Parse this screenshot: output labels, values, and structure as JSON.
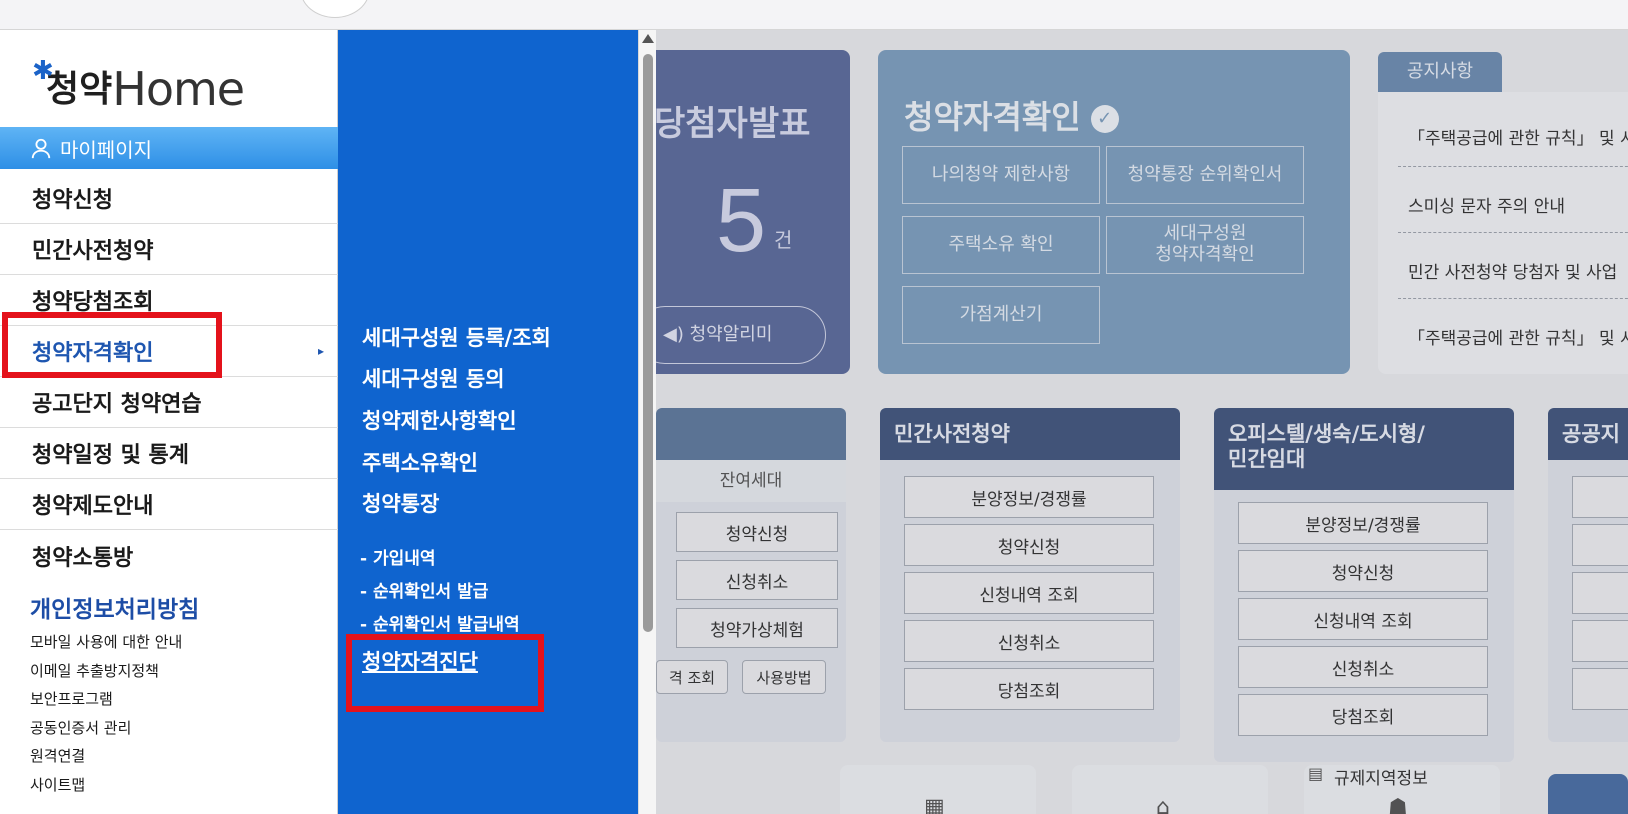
{
  "logo": {
    "mark": "청약",
    "text": "Home"
  },
  "mypage": {
    "label": "마이페이지"
  },
  "menu": [
    {
      "label": "청약신청"
    },
    {
      "label": "민간사전청약"
    },
    {
      "label": "청약당첨조회"
    },
    {
      "label": "청약자격확인",
      "arrow": "▸"
    },
    {
      "label": "공고단지 청약연습"
    },
    {
      "label": "청약일정 및 통계"
    },
    {
      "label": "청약제도안내"
    },
    {
      "label": "청약소통방"
    }
  ],
  "privacy_label": "개인정보처리방침",
  "links": [
    "모바일 사용에 대한 안내",
    "이메일 추출방지정책",
    "보안프로그램",
    "공동인증서 관리",
    "원격연결",
    "사이트맵"
  ],
  "submenu": {
    "items": [
      "세대구성원 등록/조회",
      "세대구성원 동의",
      "청약제한사항확인",
      "주택소유확인",
      "청약통장"
    ],
    "sub_items": [
      "- 가입내역",
      "- 순위확인서 발급",
      "- 순위확인서 발급내역"
    ],
    "diagnosis": "청약자격진단"
  },
  "background": {
    "winner": {
      "title": "당첨자발표",
      "count": "5",
      "unit": "건",
      "alarm": "청약알리미"
    },
    "eligibility": {
      "title": "청약자격확인",
      "buttons": [
        "나의청약 제한사항",
        "청약통장 순위확인서",
        "주택소유 확인",
        "세대구성원\n청약자격확인",
        "가점계산기"
      ]
    },
    "notice": {
      "tab": "공지사항",
      "items": [
        "「주택공급에 관한 규칙」 및 시",
        "스미싱 문자 주의 안내",
        "민간 사전청약 당첨자 및 사업",
        "「주택공급에 관한 규칙」 및 시"
      ]
    },
    "sec1": {
      "remain": "잔여세대",
      "buttons": [
        "청약신청",
        "신청취소",
        "청약가상체험"
      ],
      "bottom": [
        "격 조회",
        "사용방법"
      ]
    },
    "sec2": {
      "title": "민간사전청약",
      "buttons": [
        "분양정보/경쟁률",
        "청약신청",
        "신청내역 조회",
        "신청취소",
        "당첨조회"
      ]
    },
    "sec3": {
      "title": "오피스텔/생숙/도시형/\n민간임대",
      "buttons": [
        "분양정보/경쟁률",
        "청약신청",
        "신청내역 조회",
        "신청취소",
        "당첨조회"
      ]
    },
    "sec4": {
      "title": "공공지"
    },
    "regulation": "규제지역정보"
  },
  "colors": {
    "highlight": "#e4121b",
    "submenu_bg": "#0f64cf",
    "accent": "#1e56b0"
  }
}
